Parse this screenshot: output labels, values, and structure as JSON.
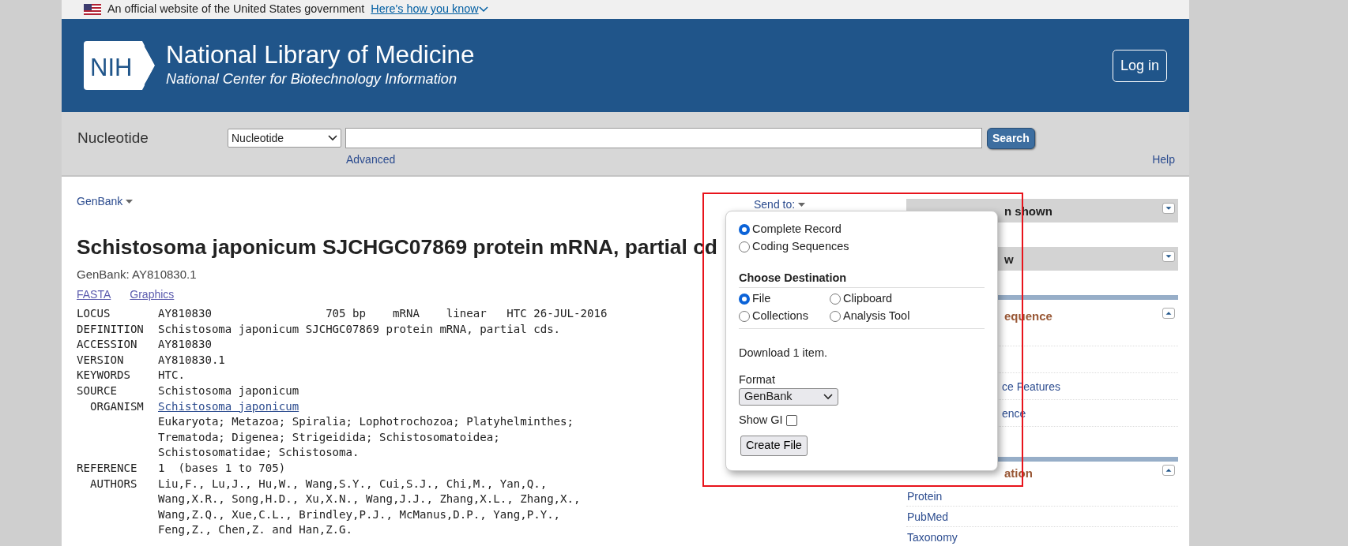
{
  "gov_banner": {
    "text": "An official website of the United States government",
    "link": "Here's how you know"
  },
  "header": {
    "logo_text": "NIH",
    "title": "National Library of Medicine",
    "subtitle": "National Center for Biotechnology Information",
    "login": "Log in"
  },
  "search_bar": {
    "database_label": "Nucleotide",
    "database_select": "Nucleotide",
    "search_button": "Search",
    "advanced": "Advanced",
    "help": "Help"
  },
  "record": {
    "format_menu": "GenBank",
    "title": "Schistosoma japonicum SJCHGC07869 protein mRNA, partial cd",
    "accession_line": "GenBank: AY810830.1",
    "links": [
      "FASTA",
      "Graphics"
    ],
    "fields": [
      {
        "label": "LOCUS",
        "value": "AY810830                 705 bp    mRNA    linear   HTC 26-JUL-2016"
      },
      {
        "label": "DEFINITION",
        "value": "Schistosoma japonicum SJCHGC07869 protein mRNA, partial cds."
      },
      {
        "label": "ACCESSION",
        "value": "AY810830"
      },
      {
        "label": "VERSION",
        "value": "AY810830.1"
      },
      {
        "label": "KEYWORDS",
        "value": "HTC."
      },
      {
        "label": "SOURCE",
        "value": "Schistosoma japonicum"
      },
      {
        "label": "  ORGANISM",
        "value": "Schistosoma japonicum",
        "kind": "link"
      },
      {
        "value": "Eukaryota; Metazoa; Spiralia; Lophotrochozoa; Platyhelminthes;"
      },
      {
        "value": "Trematoda; Digenea; Strigeidida; Schistosomatoidea;"
      },
      {
        "value": "Schistosomatidae; Schistosoma."
      },
      {
        "label": "REFERENCE",
        "value": "1  (bases 1 to 705)"
      },
      {
        "label": "  AUTHORS",
        "value": "Liu,F., Lu,J., Hu,W., Wang,S.Y., Cui,S.J., Chi,M., Yan,Q.,"
      },
      {
        "value": "Wang,X.R., Song,H.D., Xu,X.N., Wang,J.J., Zhang,X.L., Zhang,X.,"
      },
      {
        "value": "Wang,Z.Q., Xue,C.L., Brindley,P.J., McManus,D.P., Yang,P.Y.,"
      },
      {
        "value": "Feng,Z., Chen,Z. and Han,Z.G."
      }
    ]
  },
  "send_to": {
    "label": "Send to:",
    "choices": [
      {
        "label": "Complete Record",
        "selected": true
      },
      {
        "label": "Coding Sequences",
        "selected": false
      }
    ],
    "destination_heading": "Choose Destination",
    "destinations": [
      {
        "label": "File",
        "selected": true
      },
      {
        "label": "Clipboard",
        "selected": false
      },
      {
        "label": "Collections",
        "selected": false
      },
      {
        "label": "Analysis Tool",
        "selected": false
      }
    ],
    "download_text": "Download 1 item.",
    "format_label": "Format",
    "format_value": "GenBank",
    "show_gi": {
      "label": "Show GI",
      "checked": false
    },
    "create_button": "Create File"
  },
  "sidebar": [
    {
      "kind": "bar",
      "text": "n shown"
    },
    {
      "kind": "bar",
      "text": "w"
    },
    {
      "kind": "section",
      "text": "equence"
    },
    {
      "kind": "row"
    },
    {
      "kind": "row",
      "text": "ce Features"
    },
    {
      "kind": "row",
      "text": "ence"
    },
    {
      "kind": "row"
    },
    {
      "kind": "section",
      "text": "ation"
    },
    {
      "kind": "row",
      "text": "Protein"
    },
    {
      "kind": "row",
      "text": "PubMed"
    },
    {
      "kind": "row",
      "text": "Taxonomy"
    }
  ]
}
